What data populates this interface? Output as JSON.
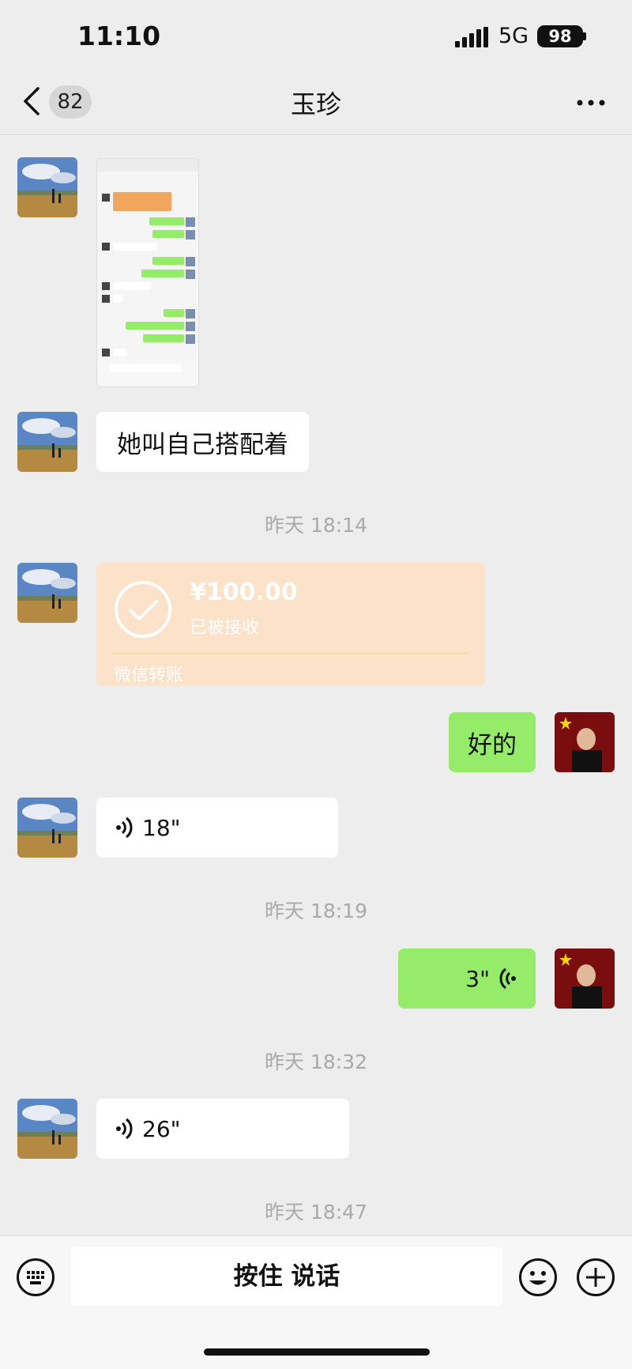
{
  "status": {
    "time": "11:10",
    "network": "5G",
    "battery": "98"
  },
  "nav": {
    "unread_count": "82",
    "title": "玉珍"
  },
  "messages": {
    "text1": "她叫自己搭配着",
    "ts1": "昨天 18:14",
    "transfer": {
      "amount": "¥100.00",
      "status": "已被接收",
      "label": "微信转账"
    },
    "text2": "好的",
    "voice1": "18\"",
    "ts2": "昨天 18:19",
    "voice2": "3\"",
    "ts3": "昨天 18:32",
    "voice3": "26\"",
    "ts4": "昨天 18:47"
  },
  "input": {
    "hold_to_talk": "按住 说话"
  },
  "colors": {
    "chat_bg": "#ededed",
    "out_bubble": "#95ec69",
    "transfer_bg": "#fbe2c8"
  }
}
